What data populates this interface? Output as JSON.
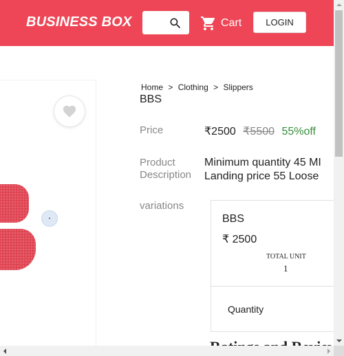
{
  "header": {
    "brand": "BUSINESS BOX",
    "search_placeholder": "",
    "search_icon": "search-icon",
    "cart_label": "Cart",
    "cart_icon": "shopping-cart-icon",
    "login_label": "LOGIN",
    "accent_color": "#ee4656"
  },
  "product": {
    "breadcrumb": [
      "Home",
      "Clothing",
      "Slippers"
    ],
    "breadcrumb_separator": ">",
    "title": "BBS",
    "wishlist_icon": "heart-icon",
    "price_label": "Price",
    "price": "₹2500",
    "original_price": "₹5500",
    "discount": "55%off",
    "description_label_line1": "Product",
    "description_label_line2": "Description",
    "description_line1": "Minimum quantity 45 MI",
    "description_line2": "Landing price 55 Loose",
    "variations_label": "variations"
  },
  "variation": {
    "name": "BBS",
    "price": "₹ 2500",
    "total_unit_label": "TOTAL UNIT",
    "total_unit_value": "1",
    "quantity_label": "Quantity"
  },
  "reviews": {
    "heading": "Ratings and Reviews"
  }
}
